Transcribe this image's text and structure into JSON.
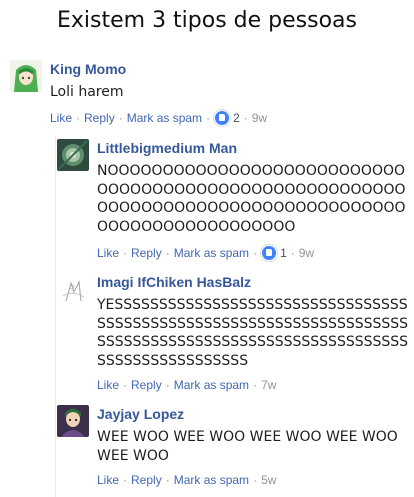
{
  "title": "Existem 3 tipos de pessoas",
  "comments": [
    {
      "name": "King Momo",
      "text": "Loli harem",
      "like": "Like",
      "reply": "Reply",
      "spam": "Mark as spam",
      "reactions": "2",
      "time": "9w"
    },
    {
      "name": "Littlebigmedium Man",
      "text": "NOOOOOOOOOOOOOOOOOOOOOOOOOOOOOOOOOOOOOOOOOOOOOOOOOOOOOOOOOOOOOOOOOOOOOOOOOOOOOOOOOOOOOOOOOOOOOOOOOOOOO",
      "like": "Like",
      "reply": "Reply",
      "spam": "Mark as spam",
      "reactions": "1",
      "time": "9w"
    },
    {
      "name": "Imagi IfChiken HasBalz",
      "text": "YESSSSSSSSSSSSSSSSSSSSSSSSSSSSSSSSSSSSSSSSSSSSSSSSSSSSSSSSSSSSSSSSSSSSSSSSSSSSSSSSSSSSSSSSSSSSSSSSSSSSSSSSSSSSSSSSSSSSSSSS",
      "like": "Like",
      "reply": "Reply",
      "spam": "Mark as spam",
      "time": "7w"
    },
    {
      "name": "Jayjay Lopez",
      "text": "WEE WOO WEE WOO WEE WOO WEE WOO WEE WOO",
      "like": "Like",
      "reply": "Reply",
      "spam": "Mark as spam",
      "time": "5w"
    }
  ],
  "colors": {
    "link": "#4267b2",
    "name": "#365899",
    "meta": "#90949c",
    "reaction": "#4080ff"
  }
}
